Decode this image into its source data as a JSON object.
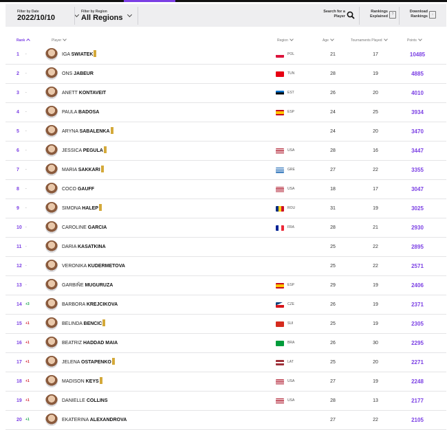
{
  "filters": {
    "date_caption": "Filter by Date",
    "date_value": "2022/10/10",
    "region_caption": "Filter by Region",
    "region_value": "All Regions"
  },
  "actions": {
    "search_line1": "Search for a",
    "search_line2": "Player",
    "explained_line1": "Rankings",
    "explained_line2": "Explained",
    "download_line1": "Download",
    "download_line2": "Rankings"
  },
  "headers": {
    "rank": "Rank",
    "player": "Player",
    "region": "Region",
    "age": "Age",
    "tournaments": "Tournaments Played",
    "points": "Points"
  },
  "players": [
    {
      "rank": "1",
      "move": "-",
      "move_dir": "none",
      "first": "IGA",
      "last": "SWIATEK",
      "tag": true,
      "flag": "pol",
      "country": "POL",
      "age": "21",
      "tournaments": "17",
      "points": "10485"
    },
    {
      "rank": "2",
      "move": "-",
      "move_dir": "none",
      "first": "ONS",
      "last": "JABEUR",
      "tag": false,
      "flag": "tun",
      "country": "TUN",
      "age": "28",
      "tournaments": "19",
      "points": "4885"
    },
    {
      "rank": "3",
      "move": "-",
      "move_dir": "none",
      "first": "ANETT",
      "last": "KONTAVEIT",
      "tag": false,
      "flag": "est",
      "country": "EST",
      "age": "26",
      "tournaments": "20",
      "points": "4010"
    },
    {
      "rank": "4",
      "move": "-",
      "move_dir": "none",
      "first": "PAULA",
      "last": "BADOSA",
      "tag": false,
      "flag": "esp",
      "country": "ESP",
      "age": "24",
      "tournaments": "25",
      "points": "3934"
    },
    {
      "rank": "5",
      "move": "-",
      "move_dir": "none",
      "first": "ARYNA",
      "last": "SABALENKA",
      "tag": true,
      "flag": "",
      "country": "",
      "age": "24",
      "tournaments": "20",
      "points": "3470"
    },
    {
      "rank": "6",
      "move": "-",
      "move_dir": "none",
      "first": "JESSICA",
      "last": "PEGULA",
      "tag": true,
      "flag": "usa",
      "country": "USA",
      "age": "28",
      "tournaments": "16",
      "points": "3447"
    },
    {
      "rank": "7",
      "move": "-",
      "move_dir": "none",
      "first": "MARIA",
      "last": "SAKKARI",
      "tag": true,
      "flag": "gre",
      "country": "GRE",
      "age": "27",
      "tournaments": "22",
      "points": "3355"
    },
    {
      "rank": "8",
      "move": "-",
      "move_dir": "none",
      "first": "COCO",
      "last": "GAUFF",
      "tag": false,
      "flag": "usa",
      "country": "USA",
      "age": "18",
      "tournaments": "17",
      "points": "3047"
    },
    {
      "rank": "9",
      "move": "-",
      "move_dir": "none",
      "first": "SIMONA",
      "last": "HALEP",
      "tag": true,
      "flag": "rou",
      "country": "ROU",
      "age": "31",
      "tournaments": "19",
      "points": "3025"
    },
    {
      "rank": "10",
      "move": "-",
      "move_dir": "none",
      "first": "CAROLINE",
      "last": "GARCIA",
      "tag": false,
      "flag": "fra",
      "country": "FRA",
      "age": "28",
      "tournaments": "21",
      "points": "2930"
    },
    {
      "rank": "11",
      "move": "-",
      "move_dir": "none",
      "first": "DARIA",
      "last": "KASATKINA",
      "tag": false,
      "flag": "",
      "country": "",
      "age": "25",
      "tournaments": "22",
      "points": "2895"
    },
    {
      "rank": "12",
      "move": "-",
      "move_dir": "none",
      "first": "VERONIKA",
      "last": "KUDERMETOVA",
      "tag": false,
      "flag": "",
      "country": "",
      "age": "25",
      "tournaments": "22",
      "points": "2571"
    },
    {
      "rank": "13",
      "move": "-",
      "move_dir": "none",
      "first": "GARBIÑE",
      "last": "MUGURUZA",
      "tag": false,
      "flag": "esp",
      "country": "ESP",
      "age": "29",
      "tournaments": "19",
      "points": "2406"
    },
    {
      "rank": "14",
      "move": "+3",
      "move_dir": "up",
      "first": "BARBORA",
      "last": "KREJCIKOVA",
      "tag": false,
      "flag": "cze",
      "country": "CZE",
      "age": "26",
      "tournaments": "19",
      "points": "2371"
    },
    {
      "rank": "15",
      "move": "+1",
      "move_dir": "down",
      "first": "BELINDA",
      "last": "BENCIC",
      "tag": true,
      "flag": "sui",
      "country": "SUI",
      "age": "25",
      "tournaments": "19",
      "points": "2305"
    },
    {
      "rank": "16",
      "move": "+1",
      "move_dir": "down",
      "first": "BEATRIZ",
      "last": "HADDAD MAIA",
      "tag": false,
      "flag": "bra",
      "country": "BRA",
      "age": "26",
      "tournaments": "30",
      "points": "2295"
    },
    {
      "rank": "17",
      "move": "+1",
      "move_dir": "down",
      "first": "JELENA",
      "last": "OSTAPENKO",
      "tag": true,
      "flag": "lat",
      "country": "LAT",
      "age": "25",
      "tournaments": "20",
      "points": "2271"
    },
    {
      "rank": "18",
      "move": "+1",
      "move_dir": "down",
      "first": "MADISON",
      "last": "KEYS",
      "tag": true,
      "flag": "usa",
      "country": "USA",
      "age": "27",
      "tournaments": "19",
      "points": "2248"
    },
    {
      "rank": "19",
      "move": "+1",
      "move_dir": "down",
      "first": "DANIELLE",
      "last": "COLLINS",
      "tag": false,
      "flag": "usa",
      "country": "USA",
      "age": "28",
      "tournaments": "13",
      "points": "2177"
    },
    {
      "rank": "20",
      "move": "+1",
      "move_dir": "up",
      "first": "EKATERINA",
      "last": "ALEXANDROVA",
      "tag": false,
      "flag": "",
      "country": "",
      "age": "27",
      "tournaments": "22",
      "points": "2105"
    }
  ],
  "colors": {
    "accent": "#7b3fe4",
    "filter_bg": "#eeeef0",
    "tag_gold": "#d4a93a"
  }
}
